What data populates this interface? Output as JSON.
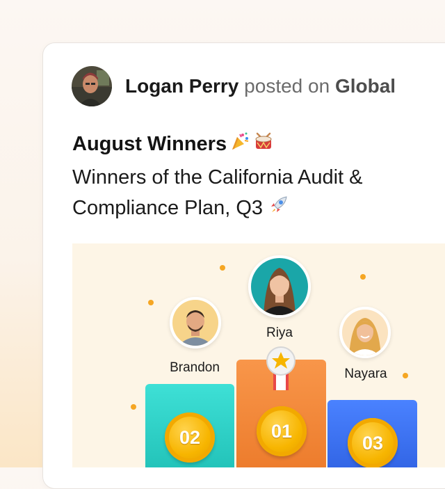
{
  "post": {
    "author": "Logan Perry",
    "posted_on": "posted on",
    "group": "Global",
    "title": "August Winners",
    "title_icons": [
      "party-popper-icon",
      "drum-icon"
    ],
    "body_line1": "Winners of the California Audit &",
    "body_line2": "Compliance Plan, Q3",
    "body_icon": "rocket-icon"
  },
  "winners": [
    {
      "name": "Brandon",
      "rank": "02",
      "podium_color": "#2fd3c9"
    },
    {
      "name": "Riya",
      "rank": "01",
      "podium_color": "#f58a3c"
    },
    {
      "name": "Nayara",
      "rank": "03",
      "podium_color": "#3b6ff0"
    }
  ],
  "colors": {
    "accent_dots": "#f5a623",
    "medal_gold": "#f7b500"
  }
}
